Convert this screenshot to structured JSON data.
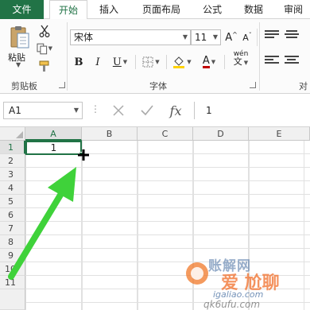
{
  "ribbon_tabs": [
    {
      "label": "文件"
    },
    {
      "label": "开始"
    },
    {
      "label": "插入"
    },
    {
      "label": "页面布局"
    },
    {
      "label": "公式"
    },
    {
      "label": "数据"
    },
    {
      "label": "审阅"
    }
  ],
  "clipboard": {
    "paste_label": "粘贴",
    "group_label": "剪贴板"
  },
  "font": {
    "font_name": "宋体",
    "font_size": "11",
    "group_label": "字体",
    "bold": "B",
    "italic": "I",
    "underline": "U",
    "grow": "A",
    "shrink": "A",
    "font_color_letter": "A",
    "phonetic": "wén"
  },
  "alignment": {
    "group_label": "对"
  },
  "formula_bar": {
    "name_box": "A1",
    "fx_label": "fx",
    "formula_value": "1"
  },
  "sheet": {
    "columns": [
      "A",
      "B",
      "C",
      "D",
      "E"
    ],
    "rows": [
      "1",
      "2",
      "3",
      "4",
      "5",
      "6",
      "7",
      "8",
      "9",
      "10",
      "11"
    ],
    "active_cell_value": "1"
  },
  "watermark": {
    "line1": "账解网",
    "line2": "爱 尬聊",
    "url1": "igaliao.com",
    "url2": "qk6ufu.com"
  },
  "colors": {
    "accent": "#217346",
    "annotation_arrow": "#3fd23a",
    "font_color": "#c00000",
    "highlight": "#ffd200"
  }
}
